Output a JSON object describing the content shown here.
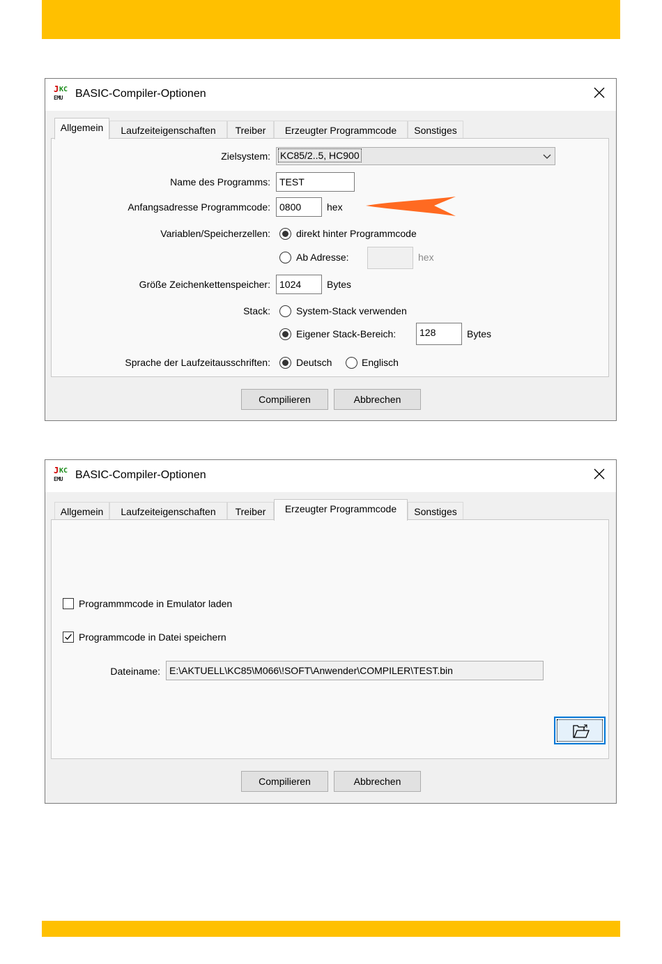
{
  "dialog_title": "BASIC-Compiler-Optionen",
  "app_icon": {
    "j": "J",
    "kc": "KC",
    "emu": "EMU"
  },
  "tabs": [
    "Allgemein",
    "Laufzeiteigenschaften",
    "Treiber",
    "Erzeugter Programmcode",
    "Sonstiges"
  ],
  "general": {
    "zielsystem_label": "Zielsystem:",
    "zielsystem_value": "KC85/2..5, HC900",
    "name_label": "Name des Programms:",
    "name_value": "TEST",
    "start_label": "Anfangsadresse Programmcode:",
    "start_value": "0800",
    "hex": "hex",
    "variables_label": "Variablen/Speicherzellen:",
    "var_option1": "direkt hinter Programmcode",
    "var_option2": "Ab Adresse:",
    "var_address_value": "",
    "string_label": "Größe Zeichenkettenspeicher:",
    "string_value": "1024",
    "bytes": "Bytes",
    "stack_label": "Stack:",
    "stack_option1": "System-Stack verwenden",
    "stack_option2": "Eigener Stack-Bereich:",
    "stack_value": "128",
    "language_label": "Sprache der Laufzeitausschriften:",
    "lang_de": "Deutsch",
    "lang_en": "Englisch"
  },
  "code": {
    "load_label": "Programmmcode in Emulator laden",
    "save_label": "Programmcode in Datei speichern",
    "load_checked": false,
    "save_checked": true,
    "filename_label": "Dateiname:",
    "filename_value": "E:\\AKTUELL\\KC85\\M066\\!SOFT\\Anwender\\COMPILER\\TEST.bin"
  },
  "buttons": {
    "compile": "Compilieren",
    "cancel": "Abbrechen"
  },
  "colors": {
    "accent_bar": "#ffc000",
    "annotation_arrow": "#ff6a21"
  }
}
